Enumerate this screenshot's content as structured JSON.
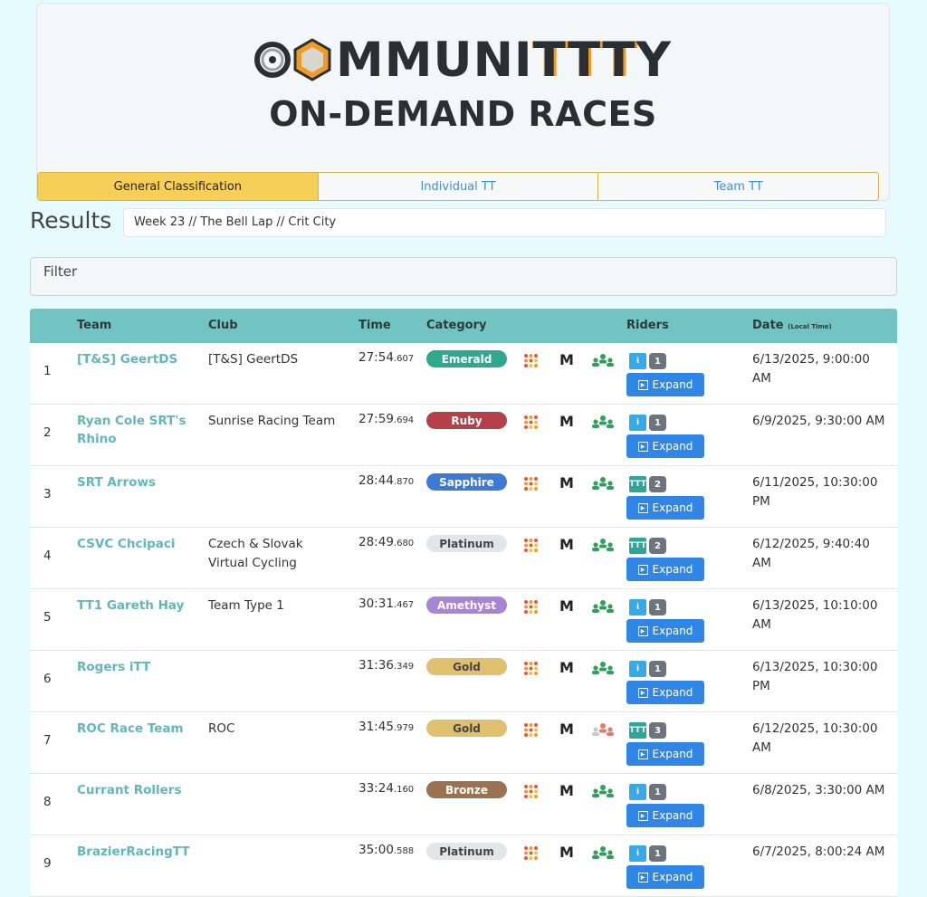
{
  "brand": {
    "logo_pre": "C",
    "logo_mid": "MMUNI",
    "logo_ttt": "TTT",
    "logo_post": "Y",
    "subtitle": "ON-DEMAND RACES",
    "accent": "#f39a25"
  },
  "tabs": [
    {
      "label": "General Classification",
      "active": true
    },
    {
      "label": "Individual TT",
      "active": false
    },
    {
      "label": "Team TT",
      "active": false
    }
  ],
  "results": {
    "title": "Results",
    "week": "Week 23 // The Bell Lap // Crit City"
  },
  "filter": {
    "label": "Filter"
  },
  "table": {
    "headers": {
      "team": "Team",
      "club": "Club",
      "time": "Time",
      "category": "Category",
      "riders": "Riders",
      "date": "Date",
      "date_note": "(Local Time)"
    },
    "expand_label": "Expand",
    "rows": [
      {
        "rank": "1",
        "team": "[T&S] GeertDS",
        "club": "[T&S] GeertDS",
        "time": "27:54",
        "ms": ".607",
        "category": "Emerald",
        "cat_color": "#2fa88e",
        "cat_text": "#ffffff",
        "rider_type": "i",
        "rider_color": "#36a9e8",
        "riders": "1",
        "people_color": "green",
        "date": "6/13/2025, 9:00:00 AM"
      },
      {
        "rank": "2",
        "team": "Ryan Cole SRT's Rhino",
        "club": "Sunrise Racing Team",
        "time": "27:59",
        "ms": ".694",
        "category": "Ruby",
        "cat_color": "#b4404a",
        "cat_text": "#ffffff",
        "rider_type": "i",
        "rider_color": "#36a9e8",
        "riders": "1",
        "people_color": "green",
        "date": "6/9/2025, 9:30:00 AM"
      },
      {
        "rank": "3",
        "team": "SRT Arrows",
        "club": "",
        "time": "28:44",
        "ms": ".870",
        "category": "Sapphire",
        "cat_color": "#3c7ad6",
        "cat_text": "#ffffff",
        "rider_type": "TTT",
        "rider_color": "#2aa69a",
        "riders": "2",
        "people_color": "green",
        "date": "6/11/2025, 10:30:00 PM"
      },
      {
        "rank": "4",
        "team": "CSVC Chcipaci",
        "club": "Czech & Slovak Virtual Cycling",
        "time": "28:49",
        "ms": ".680",
        "category": "Platinum",
        "cat_color": "#e3e5e6",
        "cat_text": "#444444",
        "rider_type": "TTT",
        "rider_color": "#2aa69a",
        "riders": "2",
        "people_color": "green",
        "date": "6/12/2025, 9:40:40 AM"
      },
      {
        "rank": "5",
        "team": "TT1 Gareth Hay",
        "club": "Team Type 1",
        "time": "30:31",
        "ms": ".467",
        "category": "Amethyst",
        "cat_color": "#a983d6",
        "cat_text": "#ffffff",
        "rider_type": "i",
        "rider_color": "#36a9e8",
        "riders": "1",
        "people_color": "green",
        "date": "6/13/2025, 10:10:00 AM"
      },
      {
        "rank": "6",
        "team": "Rogers iTT",
        "club": "",
        "time": "31:36",
        "ms": ".349",
        "category": "Gold",
        "cat_color": "#dfc06f",
        "cat_text": "#444444",
        "rider_type": "i",
        "rider_color": "#36a9e8",
        "riders": "1",
        "people_color": "green",
        "date": "6/13/2025, 10:30:00 PM"
      },
      {
        "rank": "7",
        "team": "ROC Race Team",
        "club": "ROC",
        "time": "31:45",
        "ms": ".979",
        "category": "Gold",
        "cat_color": "#dfc06f",
        "cat_text": "#444444",
        "rider_type": "TTT",
        "rider_color": "#2aa69a",
        "riders": "3",
        "people_color": "red",
        "date": "6/12/2025, 10:30:00 AM"
      },
      {
        "rank": "8",
        "team": "Currant Rollers",
        "club": "",
        "time": "33:24",
        "ms": ".160",
        "category": "Bronze",
        "cat_color": "#9b7250",
        "cat_text": "#ffffff",
        "rider_type": "i",
        "rider_color": "#36a9e8",
        "riders": "1",
        "people_color": "green",
        "date": "6/8/2025, 3:30:00 AM"
      },
      {
        "rank": "9",
        "team": "BrazierRacingTT",
        "club": "",
        "time": "35:00",
        "ms": ".588",
        "category": "Platinum",
        "cat_color": "#e3e5e6",
        "cat_text": "#444444",
        "rider_type": "i",
        "rider_color": "#36a9e8",
        "riders": "1",
        "people_color": "green",
        "date": "6/7/2025, 8:00:24 AM"
      }
    ]
  }
}
